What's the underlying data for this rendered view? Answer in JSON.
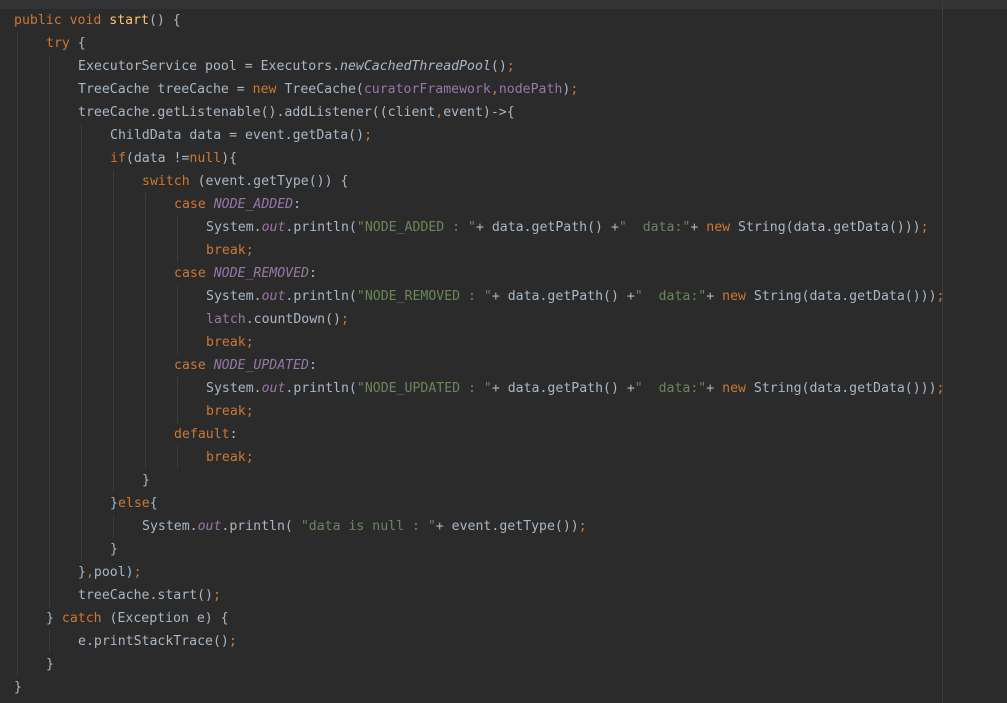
{
  "editor": {
    "colors": {
      "background": "#2b2b2b",
      "keyword": "#cc7832",
      "method_declaration": "#ffc66d",
      "string": "#6a8759",
      "field": "#9876aa",
      "default_text": "#a9b7c6"
    },
    "lines": [
      {
        "indent": 0,
        "tokens": [
          {
            "t": "public void ",
            "c": "k"
          },
          {
            "t": "start",
            "c": "f"
          },
          {
            "t": "() {",
            "c": "w"
          }
        ]
      },
      {
        "indent": 1,
        "tokens": [
          {
            "t": "try ",
            "c": "k"
          },
          {
            "t": "{",
            "c": "w"
          }
        ]
      },
      {
        "indent": 2,
        "tokens": [
          {
            "t": "ExecutorService pool = Executors.",
            "c": "w"
          },
          {
            "t": "newCachedThreadPool",
            "c": "i"
          },
          {
            "t": "()",
            "c": "w"
          },
          {
            "t": ";",
            "c": "k"
          }
        ]
      },
      {
        "indent": 2,
        "tokens": [
          {
            "t": "TreeCache treeCache = ",
            "c": "w"
          },
          {
            "t": "new ",
            "c": "k"
          },
          {
            "t": "TreeCache(",
            "c": "w"
          },
          {
            "t": "curatorFramework",
            "c": "p"
          },
          {
            "t": ",",
            "c": "k"
          },
          {
            "t": "nodePath",
            "c": "p"
          },
          {
            "t": ")",
            "c": "w"
          },
          {
            "t": ";",
            "c": "k"
          }
        ]
      },
      {
        "indent": 2,
        "tokens": [
          {
            "t": "treeCache.getListenable().addListener((client",
            "c": "w"
          },
          {
            "t": ",",
            "c": "k"
          },
          {
            "t": "event)->{",
            "c": "w"
          }
        ]
      },
      {
        "indent": 3,
        "tokens": [
          {
            "t": "ChildData data = event.getData()",
            "c": "w"
          },
          {
            "t": ";",
            "c": "k"
          }
        ]
      },
      {
        "indent": 3,
        "tokens": [
          {
            "t": "if",
            "c": "k"
          },
          {
            "t": "(data !=",
            "c": "w"
          },
          {
            "t": "null",
            "c": "k"
          },
          {
            "t": "){",
            "c": "w"
          }
        ]
      },
      {
        "indent": 4,
        "tokens": [
          {
            "t": "switch ",
            "c": "k"
          },
          {
            "t": "(event.getType()) {",
            "c": "w"
          }
        ]
      },
      {
        "indent": 5,
        "tokens": [
          {
            "t": "case ",
            "c": "k"
          },
          {
            "t": "NODE_ADDED",
            "c": "pi"
          },
          {
            "t": ":",
            "c": "w"
          }
        ]
      },
      {
        "indent": 6,
        "tokens": [
          {
            "t": "System.",
            "c": "w"
          },
          {
            "t": "out",
            "c": "pi"
          },
          {
            "t": ".println(",
            "c": "w"
          },
          {
            "t": "\"NODE_ADDED : \"",
            "c": "s"
          },
          {
            "t": "+ data.getPath() +",
            "c": "w"
          },
          {
            "t": "\"  data:\"",
            "c": "s"
          },
          {
            "t": "+ ",
            "c": "w"
          },
          {
            "t": "new ",
            "c": "k"
          },
          {
            "t": "String(data.getData()))",
            "c": "w"
          },
          {
            "t": ";",
            "c": "k"
          }
        ]
      },
      {
        "indent": 6,
        "tokens": [
          {
            "t": "break;",
            "c": "k"
          }
        ]
      },
      {
        "indent": 5,
        "tokens": [
          {
            "t": "case ",
            "c": "k"
          },
          {
            "t": "NODE_REMOVED",
            "c": "pi"
          },
          {
            "t": ":",
            "c": "w"
          }
        ]
      },
      {
        "indent": 6,
        "tokens": [
          {
            "t": "System.",
            "c": "w"
          },
          {
            "t": "out",
            "c": "pi"
          },
          {
            "t": ".println(",
            "c": "w"
          },
          {
            "t": "\"NODE_REMOVED : \"",
            "c": "s"
          },
          {
            "t": "+ data.getPath() +",
            "c": "w"
          },
          {
            "t": "\"  data:\"",
            "c": "s"
          },
          {
            "t": "+ ",
            "c": "w"
          },
          {
            "t": "new ",
            "c": "k"
          },
          {
            "t": "String(data.getData()))",
            "c": "w"
          },
          {
            "t": ";",
            "c": "k"
          }
        ]
      },
      {
        "indent": 6,
        "tokens": [
          {
            "t": "latch",
            "c": "p"
          },
          {
            "t": ".countDown()",
            "c": "w"
          },
          {
            "t": ";",
            "c": "k"
          }
        ]
      },
      {
        "indent": 6,
        "tokens": [
          {
            "t": "break;",
            "c": "k"
          }
        ]
      },
      {
        "indent": 5,
        "tokens": [
          {
            "t": "case ",
            "c": "k"
          },
          {
            "t": "NODE_UPDATED",
            "c": "pi"
          },
          {
            "t": ":",
            "c": "w"
          }
        ]
      },
      {
        "indent": 6,
        "tokens": [
          {
            "t": "System.",
            "c": "w"
          },
          {
            "t": "out",
            "c": "pi"
          },
          {
            "t": ".println(",
            "c": "w"
          },
          {
            "t": "\"NODE_UPDATED : \"",
            "c": "s"
          },
          {
            "t": "+ data.getPath() +",
            "c": "w"
          },
          {
            "t": "\"  data:\"",
            "c": "s"
          },
          {
            "t": "+ ",
            "c": "w"
          },
          {
            "t": "new ",
            "c": "k"
          },
          {
            "t": "String(data.getData()))",
            "c": "w"
          },
          {
            "t": ";",
            "c": "k"
          }
        ]
      },
      {
        "indent": 6,
        "tokens": [
          {
            "t": "break;",
            "c": "k"
          }
        ]
      },
      {
        "indent": 5,
        "tokens": [
          {
            "t": "default",
            "c": "k"
          },
          {
            "t": ":",
            "c": "w"
          }
        ]
      },
      {
        "indent": 6,
        "tokens": [
          {
            "t": "break;",
            "c": "k"
          }
        ]
      },
      {
        "indent": 4,
        "tokens": [
          {
            "t": "}",
            "c": "w"
          }
        ]
      },
      {
        "indent": 3,
        "tokens": [
          {
            "t": "}",
            "c": "w"
          },
          {
            "t": "else",
            "c": "k"
          },
          {
            "t": "{",
            "c": "w"
          }
        ]
      },
      {
        "indent": 4,
        "tokens": [
          {
            "t": "System.",
            "c": "w"
          },
          {
            "t": "out",
            "c": "pi"
          },
          {
            "t": ".println( ",
            "c": "w"
          },
          {
            "t": "\"data is null : \"",
            "c": "s"
          },
          {
            "t": "+ event.getType())",
            "c": "w"
          },
          {
            "t": ";",
            "c": "k"
          }
        ]
      },
      {
        "indent": 3,
        "tokens": [
          {
            "t": "}",
            "c": "w"
          }
        ]
      },
      {
        "indent": 2,
        "tokens": [
          {
            "t": "}",
            "c": "w"
          },
          {
            "t": ",",
            "c": "k"
          },
          {
            "t": "pool)",
            "c": "w"
          },
          {
            "t": ";",
            "c": "k"
          }
        ]
      },
      {
        "indent": 2,
        "tokens": [
          {
            "t": "treeCache.start()",
            "c": "w"
          },
          {
            "t": ";",
            "c": "k"
          }
        ]
      },
      {
        "indent": 1,
        "tokens": [
          {
            "t": "} ",
            "c": "w"
          },
          {
            "t": "catch ",
            "c": "k"
          },
          {
            "t": "(Exception e) {",
            "c": "w"
          }
        ]
      },
      {
        "indent": 2,
        "tokens": [
          {
            "t": "e.printStackTrace()",
            "c": "w"
          },
          {
            "t": ";",
            "c": "k"
          }
        ]
      },
      {
        "indent": 1,
        "tokens": [
          {
            "t": "}",
            "c": "w"
          }
        ]
      },
      {
        "indent": 0,
        "tokens": [
          {
            "t": "}",
            "c": "w"
          }
        ]
      }
    ]
  }
}
